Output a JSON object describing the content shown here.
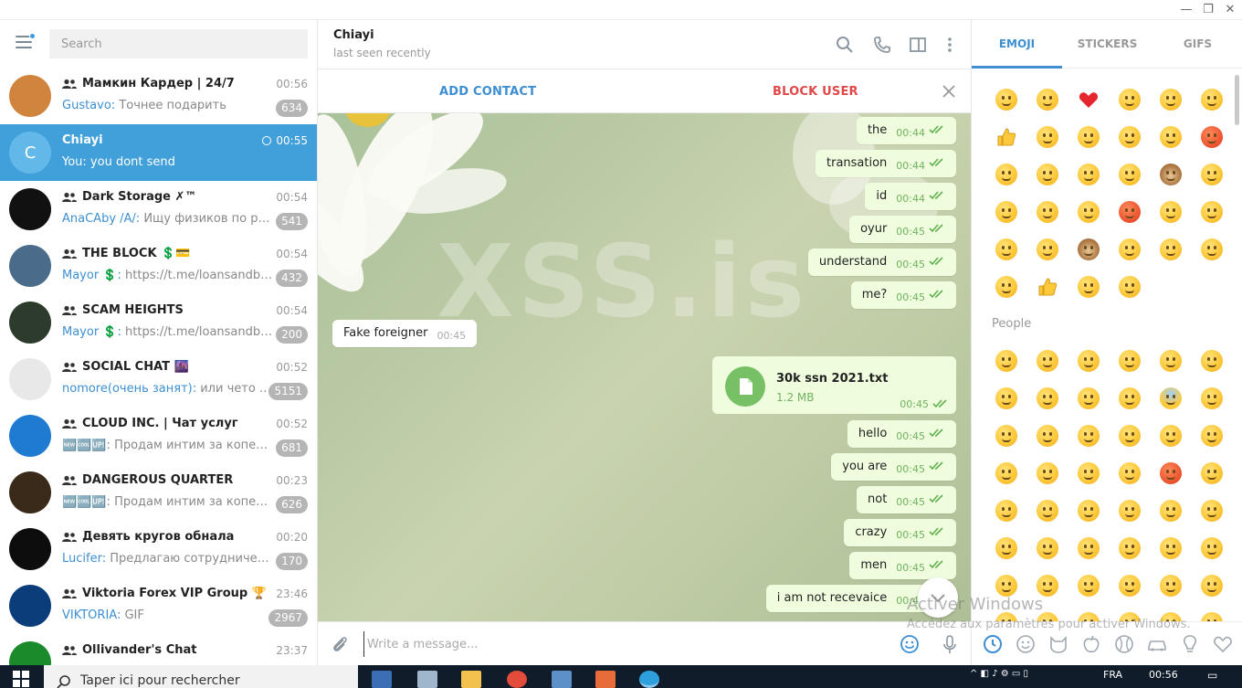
{
  "window": {
    "minimize": "—",
    "restore": "❐",
    "close": "✕"
  },
  "search": {
    "placeholder": "Search"
  },
  "chats": [
    {
      "name": "Мамкин Кардер | 24/7",
      "time": "00:56",
      "sender": "Gustavo:",
      "preview": " Точнее подарить",
      "badge": "634",
      "avatar_color": "#d0843d"
    },
    {
      "name": "Chiayi",
      "time": "00:55",
      "sender": "",
      "preview": "You: you dont send",
      "badge": "",
      "avatar_letter": "C",
      "avatar_color": "#62b8e8",
      "active": true
    },
    {
      "name": "Dark Storage ✗™",
      "time": "00:54",
      "sender": "AnaCAby /A/:",
      "preview": " Ищу физиков по ру, с ...",
      "badge": "541",
      "avatar_color": "#111111"
    },
    {
      "name": "THE BLOCK 💲💳",
      "time": "00:54",
      "sender": "Mayor 💲:",
      "preview": " https://t.me/loansandben...",
      "badge": "432",
      "avatar_color": "#4a6b8a"
    },
    {
      "name": "SCAM HEIGHTS",
      "time": "00:54",
      "sender": "Mayor 💲:",
      "preview": " https://t.me/loansandben...",
      "badge": "200",
      "avatar_color": "#2d3b2d"
    },
    {
      "name": "SOCIAL CHAT 🌆",
      "time": "00:52",
      "sender": "nomore(очень занят):",
      "preview": " или чето так...",
      "badge": "5151",
      "avatar_color": "#e8e8e8"
    },
    {
      "name": "CLOUD INC. | Чат услуг",
      "time": "00:52",
      "sender": "",
      "preview": "🆕🆒🆙: Продам интим за копейк...",
      "badge": "681",
      "avatar_color": "#1f7ad1"
    },
    {
      "name": "DANGEROUS QUARTER",
      "time": "00:23",
      "sender": "",
      "preview": "🆕🆒🆙: Продам интим за копейк...",
      "badge": "626",
      "avatar_color": "#3a2a1a"
    },
    {
      "name": "Девять кругов обнала",
      "time": "00:20",
      "sender": "Lucifer:",
      "preview": " Предлагаю сотрудничество ...",
      "badge": "170",
      "avatar_color": "#0d0d0d"
    },
    {
      "name": "Viktoria Forex VIP Group 🏆",
      "time": "23:46",
      "sender": "VIKTORIA:",
      "preview": " GIF",
      "badge": "2967",
      "avatar_color": "#0b3d7a"
    },
    {
      "name": "Ollivander's Chat",
      "time": "23:37",
      "sender": "",
      "preview": "",
      "badge": "",
      "avatar_color": "#1b8a2a"
    }
  ],
  "header": {
    "name": "Chiayi",
    "status": "last seen recently"
  },
  "actions": {
    "add_contact": "ADD CONTACT",
    "block_user": "BLOCK USER"
  },
  "wallpaper": {
    "watermark": "XSS.is"
  },
  "messages": [
    {
      "text": "the",
      "time": "00:44",
      "dir": "out"
    },
    {
      "text": "transation",
      "time": "00:44",
      "dir": "out"
    },
    {
      "text": "id",
      "time": "00:44",
      "dir": "out"
    },
    {
      "text": "oyur",
      "time": "00:45",
      "dir": "out"
    },
    {
      "text": "understand",
      "time": "00:45",
      "dir": "out"
    },
    {
      "text": "me?",
      "time": "00:45",
      "dir": "out"
    },
    {
      "text": "Fake foreigner",
      "time": "00:45",
      "dir": "in"
    },
    {
      "text": "hello",
      "time": "00:45",
      "dir": "out"
    },
    {
      "text": "you are",
      "time": "00:45",
      "dir": "out"
    },
    {
      "text": "not",
      "time": "00:45",
      "dir": "out"
    },
    {
      "text": "crazy",
      "time": "00:45",
      "dir": "out"
    },
    {
      "text": "men",
      "time": "00:45",
      "dir": "out"
    },
    {
      "text": "i am not recevaice",
      "time": "00:45",
      "dir": "out"
    }
  ],
  "file": {
    "name": "30k ssn 2021.txt",
    "size": "1.2 MB",
    "time": "00:45"
  },
  "composer": {
    "placeholder": "Write a message..."
  },
  "panel_tabs": {
    "emoji": "EMOJI",
    "stickers": "STICKERS",
    "gifs": "GIFS"
  },
  "emoji_section": "People",
  "activation": {
    "line1": "Activer Windows",
    "line2": "Accédez aux paramètres pour activer Windows."
  },
  "taskbar": {
    "search_text": "Taper ici pour rechercher",
    "lang": "FRA",
    "time": "00:56"
  }
}
